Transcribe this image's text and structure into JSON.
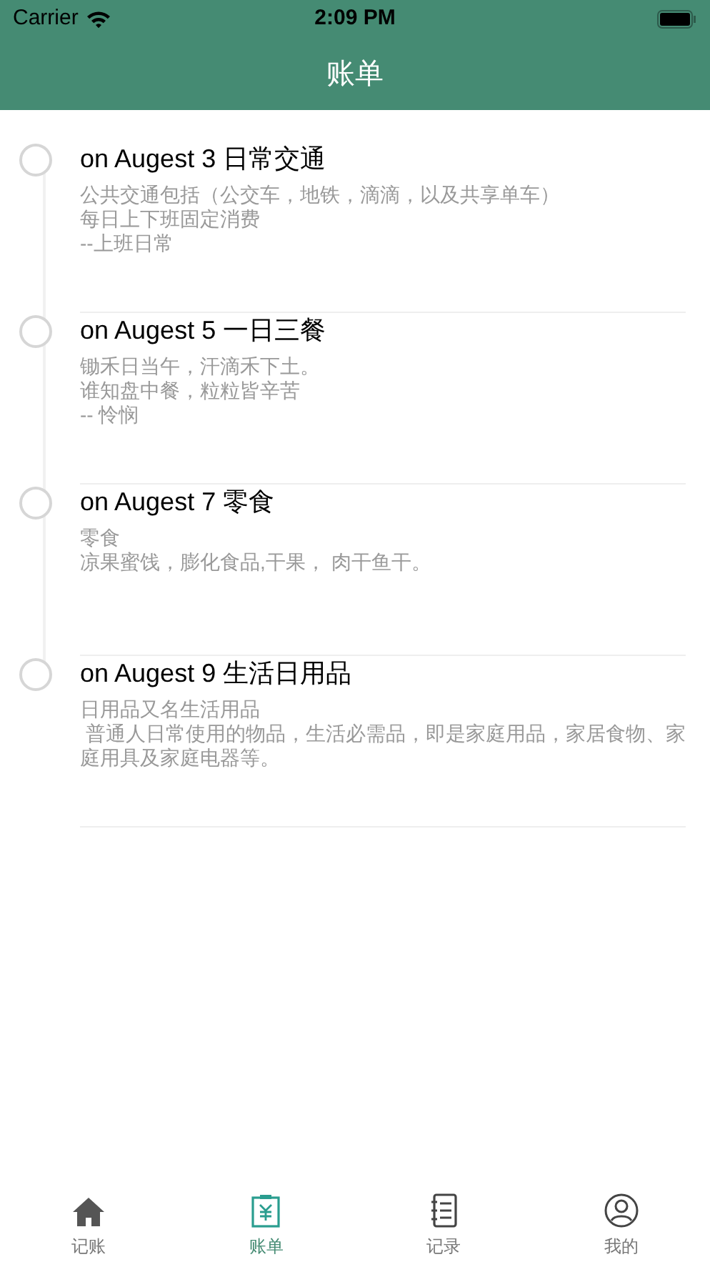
{
  "status_bar": {
    "carrier": "Carrier",
    "time": "2:09 PM"
  },
  "nav_bar": {
    "title": "账单"
  },
  "timeline": [
    {
      "title": "on Augest 3 日常交通",
      "lines": [
        "公共交通包括（公交车，地铁，滴滴，以及共享单车）",
        "每日上下班固定消费",
        "--上班日常"
      ]
    },
    {
      "title": "on Augest 5 一日三餐",
      "lines": [
        "锄禾日当午，汗滴禾下土。",
        "谁知盘中餐，粒粒皆辛苦",
        "-- 怜悯"
      ]
    },
    {
      "title": "on Augest 7 零食",
      "lines": [
        "零食",
        "凉果蜜饯，膨化食品,干果， 肉干鱼干。"
      ]
    },
    {
      "title": "on Augest 9 生活日用品",
      "lines": [
        "日用品又名生活用品",
        " 普通人日常使用的物品，生活必需品，即是家庭用品，家居食物、家庭用具及家庭电器等。"
      ]
    }
  ],
  "tab_bar": [
    {
      "kind": "home",
      "label": "记账",
      "selected": false
    },
    {
      "kind": "bill",
      "label": "账单",
      "selected": true
    },
    {
      "kind": "notebook",
      "label": "记录",
      "selected": false
    },
    {
      "kind": "profile",
      "label": "我的",
      "selected": false
    }
  ]
}
